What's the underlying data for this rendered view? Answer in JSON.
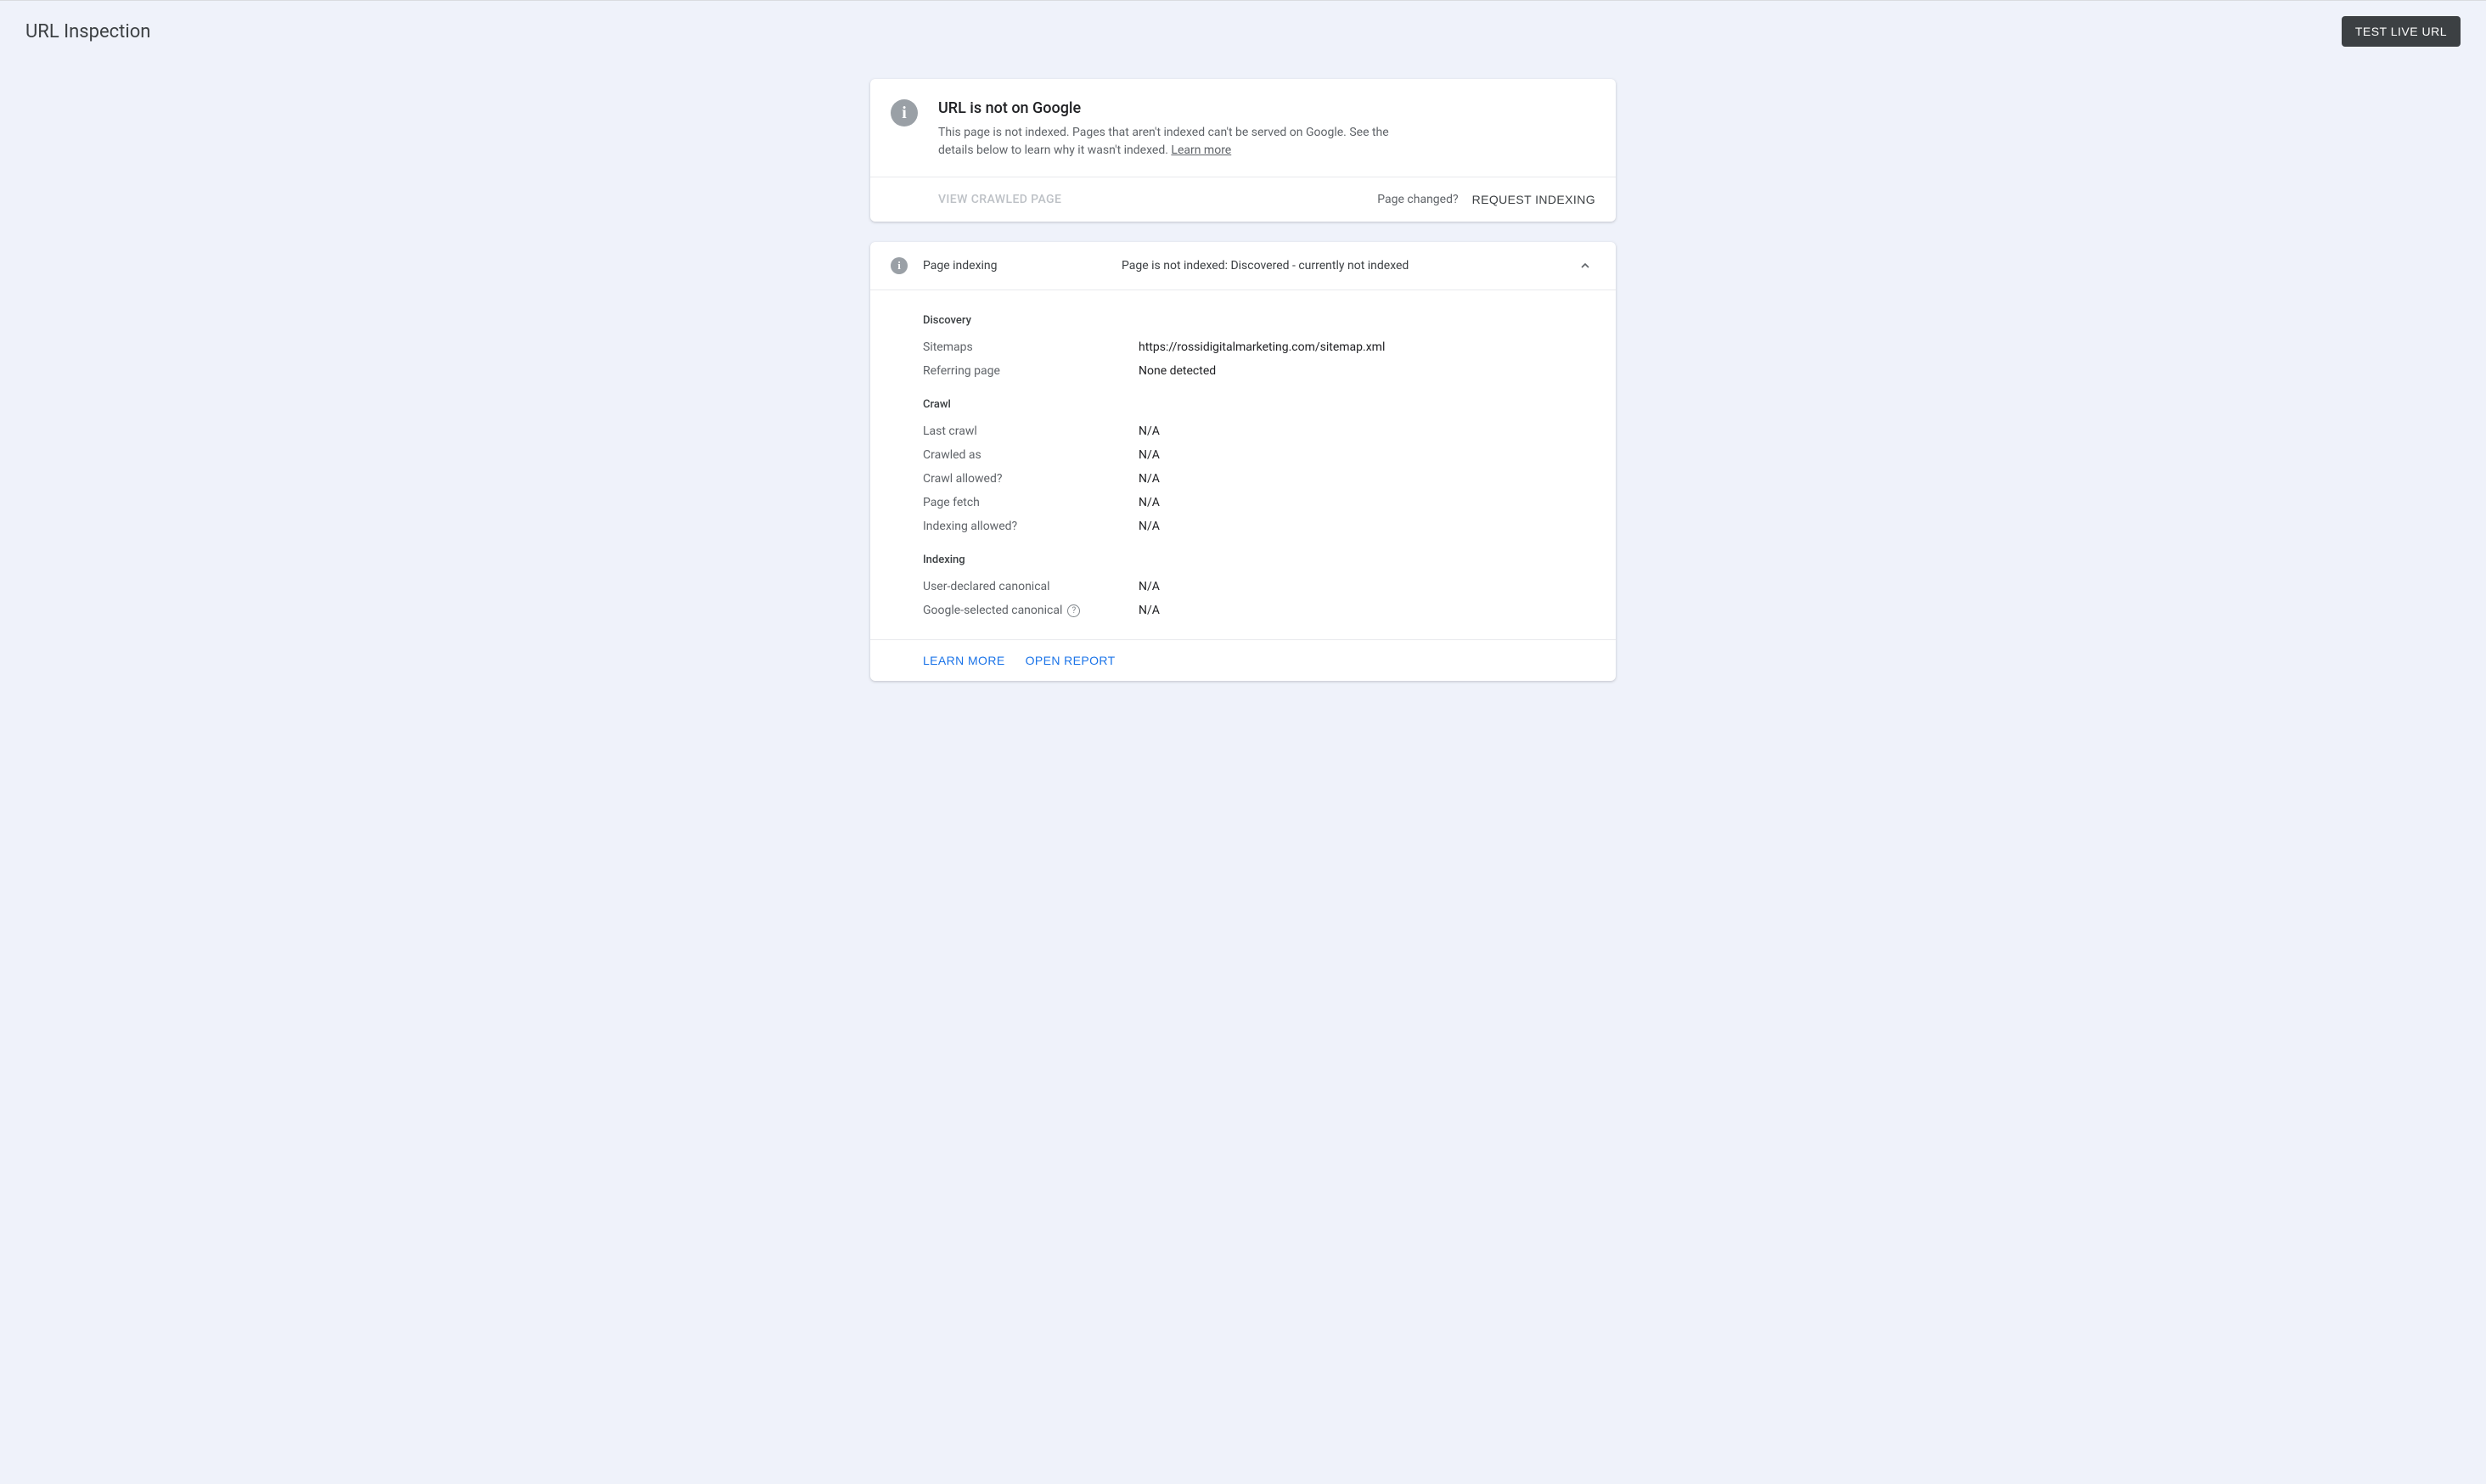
{
  "header": {
    "title": "URL Inspection",
    "test_live_label": "TEST LIVE URL"
  },
  "status": {
    "heading": "URL is not on Google",
    "description": "This page is not indexed. Pages that aren't indexed can't be served on Google. See the details below to learn why it wasn't indexed. ",
    "learn_more": "Learn more"
  },
  "actions": {
    "view_crawled": "VIEW CRAWLED PAGE",
    "page_changed": "Page changed?",
    "request_indexing": "REQUEST INDEXING"
  },
  "panel": {
    "label": "Page indexing",
    "status": "Page is not indexed: Discovered - currently not indexed"
  },
  "discovery": {
    "title": "Discovery",
    "sitemaps_label": "Sitemaps",
    "sitemaps_value": "https://rossidigitalmarketing.com/sitemap.xml",
    "referring_label": "Referring page",
    "referring_value": "None detected"
  },
  "crawl": {
    "title": "Crawl",
    "last_crawl_label": "Last crawl",
    "last_crawl_value": "N/A",
    "crawled_as_label": "Crawled as",
    "crawled_as_value": "N/A",
    "crawl_allowed_label": "Crawl allowed?",
    "crawl_allowed_value": "N/A",
    "page_fetch_label": "Page fetch",
    "page_fetch_value": "N/A",
    "indexing_allowed_label": "Indexing allowed?",
    "indexing_allowed_value": "N/A"
  },
  "indexing": {
    "title": "Indexing",
    "user_canonical_label": "User-declared canonical",
    "user_canonical_value": "N/A",
    "google_canonical_label": "Google-selected canonical",
    "google_canonical_value": "N/A"
  },
  "bottom": {
    "learn_more": "LEARN MORE",
    "open_report": "OPEN REPORT"
  }
}
